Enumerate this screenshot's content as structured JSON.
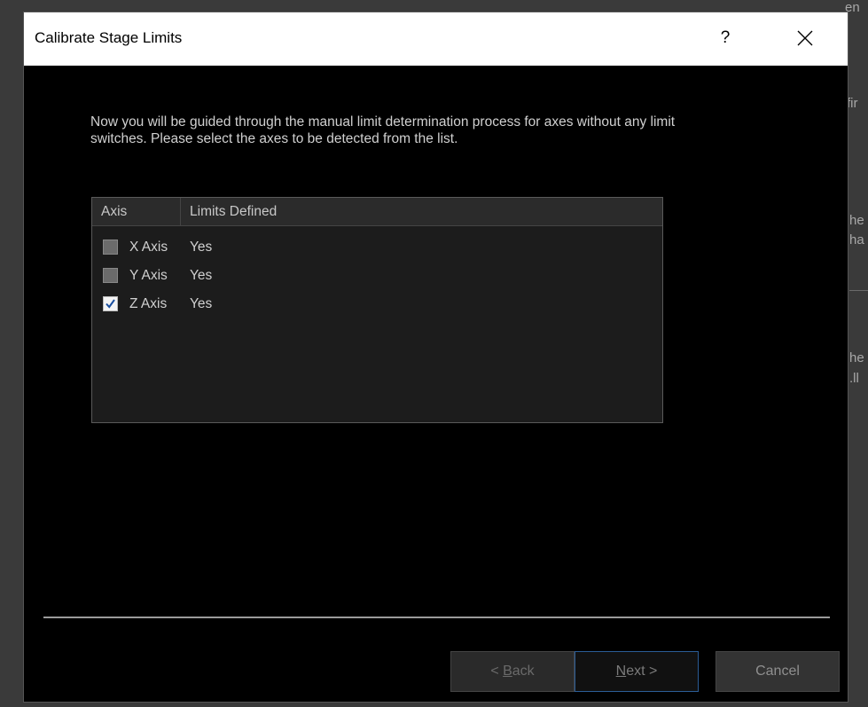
{
  "dialog": {
    "title": "Calibrate Stage Limits",
    "help_label": "?",
    "instructions": "Now you will be guided through the manual limit determination process for axes without any limit switches. Please select the axes to be detected from the list.",
    "columns": {
      "axis": "Axis",
      "limits": "Limits Defined"
    },
    "rows": [
      {
        "axis": "X Axis",
        "limits": "Yes",
        "checked": false
      },
      {
        "axis": "Y Axis",
        "limits": "Yes",
        "checked": false
      },
      {
        "axis": "Z Axis",
        "limits": "Yes",
        "checked": true
      }
    ],
    "buttons": {
      "back_prefix": "< ",
      "back_key": "B",
      "back_rest": "ack",
      "next_key": "N",
      "next_rest": "ext >",
      "cancel": "Cancel"
    }
  },
  "colors": {
    "accent": "#2b5c96",
    "check": "#1a4fa0"
  }
}
